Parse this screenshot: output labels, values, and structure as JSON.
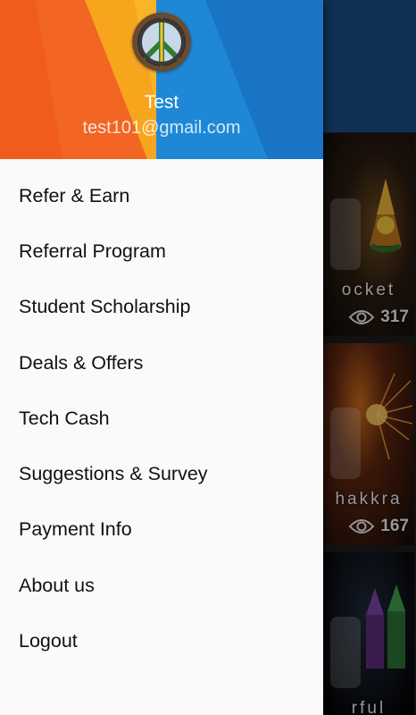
{
  "drawer": {
    "header": {
      "avatar_icon": "peace-sign-icon",
      "user_name": "Test",
      "user_email": "test101@gmail.com",
      "colors": {
        "orange": "#f26522",
        "amber": "#f7a51c",
        "blue": "#1e88d6"
      }
    },
    "menu": [
      {
        "label": "Refer & Earn"
      },
      {
        "label": "Referral Program"
      },
      {
        "label": "Student Scholarship"
      },
      {
        "label": "Deals & Offers"
      },
      {
        "label": "Tech Cash"
      },
      {
        "label": "Suggestions & Survey"
      },
      {
        "label": "Payment Info"
      },
      {
        "label": "About us"
      },
      {
        "label": "Logout"
      }
    ]
  },
  "background_cards": [
    {
      "title": "ocket",
      "views": "317",
      "icon": "eye-icon"
    },
    {
      "title": "hakkra",
      "views": "167",
      "icon": "eye-icon"
    },
    {
      "title": "rful"
    }
  ]
}
